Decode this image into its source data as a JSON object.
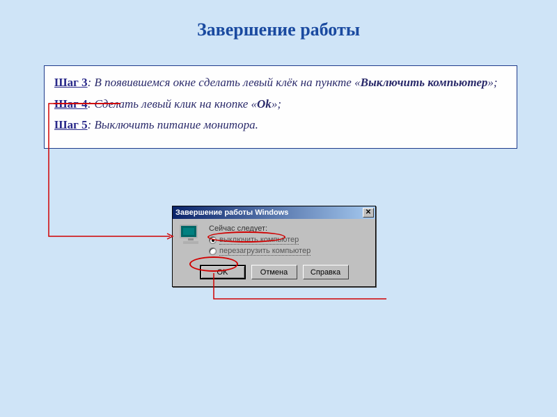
{
  "title": "Завершение работы",
  "steps": {
    "s3": {
      "label": "Шаг 3",
      "text_before": ": В появившемся окне сделать левый клёк на пункте «",
      "emph": "Выключить компьютер",
      "text_after": "»;"
    },
    "s4": {
      "label": "Шаг 4",
      "text_before": ": Сделать левый клик на кнопке «",
      "emph": "Ok",
      "text_after": "»;"
    },
    "s5": {
      "label": "Шаг 5",
      "text": ": Выключить питание монитора."
    }
  },
  "dialog": {
    "title": "Завершение работы Windows",
    "prompt": "Сейчас следует:",
    "opt_shutdown": "выключить компьютер",
    "opt_restart": "перезагрузить компьютер",
    "ok": "OK",
    "cancel": "Отмена",
    "help": "Справка",
    "close_glyph": "✕"
  }
}
